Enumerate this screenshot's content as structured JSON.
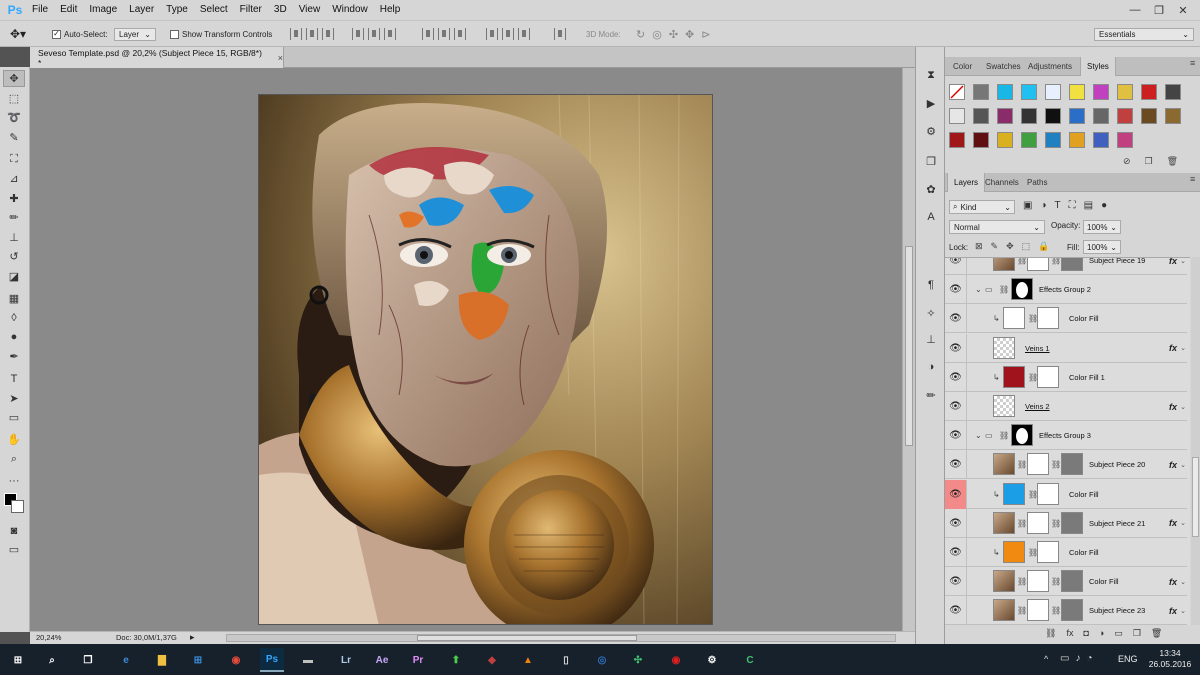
{
  "app": {
    "logo": "Ps"
  },
  "menu": [
    "File",
    "Edit",
    "Image",
    "Layer",
    "Type",
    "Select",
    "Filter",
    "3D",
    "View",
    "Window",
    "Help"
  ],
  "window_controls": {
    "minimize": "—",
    "maximize": "❐",
    "close": "✕"
  },
  "options": {
    "auto_select_label": "Auto-Select:",
    "auto_select_checked": true,
    "auto_select_target": "Layer",
    "transform_controls_label": "Show Transform Controls",
    "mode_label": "3D Mode:",
    "workspace": "Essentials"
  },
  "document": {
    "tab_title": "Seveso Template.psd @ 20,2% (Subject Piece 15, RGB/8*) *",
    "close": "×"
  },
  "status": {
    "zoom": "20,24%",
    "doc": "Doc: 30,0M/1,37G"
  },
  "tools": [
    {
      "icon": "move-icon",
      "glyph": "✥"
    },
    {
      "icon": "marquee-icon",
      "glyph": "⬚"
    },
    {
      "icon": "lasso-icon",
      "glyph": "➰"
    },
    {
      "icon": "quick-select-icon",
      "glyph": "✎"
    },
    {
      "icon": "crop-icon",
      "glyph": "⛶"
    },
    {
      "icon": "eyedropper-icon",
      "glyph": "⊿"
    },
    {
      "icon": "healing-brush-icon",
      "glyph": "✚"
    },
    {
      "icon": "brush-icon",
      "glyph": "✏"
    },
    {
      "icon": "clone-stamp-icon",
      "glyph": "⊥"
    },
    {
      "icon": "history-brush-icon",
      "glyph": "↺"
    },
    {
      "icon": "eraser-icon",
      "glyph": "◪"
    },
    {
      "icon": "gradient-icon",
      "glyph": "▦"
    },
    {
      "icon": "blur-icon",
      "glyph": "◊"
    },
    {
      "icon": "dodge-icon",
      "glyph": "●"
    },
    {
      "icon": "pen-icon",
      "glyph": "✒"
    },
    {
      "icon": "type-icon",
      "glyph": "T"
    },
    {
      "icon": "path-select-icon",
      "glyph": "➤"
    },
    {
      "icon": "shape-icon",
      "glyph": "▭"
    },
    {
      "icon": "hand-icon",
      "glyph": "✋"
    },
    {
      "icon": "zoom-icon",
      "glyph": "⌕"
    },
    {
      "icon": "more-tools-icon",
      "glyph": "···"
    }
  ],
  "side_strip_icons": [
    {
      "icon": "history-icon",
      "glyph": "⧗"
    },
    {
      "icon": "play-actions-icon",
      "glyph": "▶"
    },
    {
      "icon": "properties-icon",
      "glyph": "⚙"
    },
    {
      "icon": "clone-source-icon",
      "glyph": "❐"
    },
    {
      "icon": "brush-presets-icon",
      "glyph": "✿"
    },
    {
      "icon": "character-icon",
      "glyph": "A"
    },
    {
      "icon": "paragraph-icon",
      "glyph": "¶"
    },
    {
      "icon": "tool-presets-icon",
      "glyph": "✧"
    },
    {
      "icon": "3d-icon",
      "glyph": "⊥"
    },
    {
      "icon": "adjustments-icon",
      "glyph": "◑"
    },
    {
      "icon": "brush-icon",
      "glyph": "✏"
    }
  ],
  "panels": {
    "color_tabs": [
      "Color",
      "Swatches",
      "Adjustments",
      "Styles"
    ],
    "active_color_tab": "Styles",
    "styles": [
      "#ffffff",
      "#777777",
      "#18b7e6",
      "#20c0f0",
      "#e8f0ff",
      "#f0e040",
      "#c040c0",
      "#e0c040",
      "#cc2020",
      "#444444",
      "#e6e6e6",
      "#555555",
      "#8a2c6a",
      "#333333",
      "#101010",
      "#2a6ec8",
      "#666666",
      "#c04040",
      "#6a4a20",
      "#8a6a30",
      "#a01818",
      "#601010",
      "#d8b020",
      "#40a040",
      "#2080c0",
      "#e0a020",
      "#4060c0",
      "#c04080"
    ],
    "layers_tabs": [
      "Layers",
      "Channels",
      "Paths"
    ],
    "active_layers_tab": "Layers",
    "filter_kind": "Kind",
    "blend_mode": "Normal",
    "opacity_label": "Opacity:",
    "opacity": "100%",
    "lock_label": "Lock:",
    "fill_label": "Fill:",
    "fill": "100%"
  },
  "layers": [
    {
      "name": "Subject Piece 19",
      "indent": 1,
      "kind": "photo",
      "fx": "fx",
      "eye": true
    },
    {
      "name": "Effects Group 2",
      "indent": 1,
      "kind": "group",
      "fx": "",
      "eye": true
    },
    {
      "name": "Color Fill",
      "indent": 2,
      "kind": "fill",
      "color": "#ffffff",
      "fx": "",
      "eye": true
    },
    {
      "name": "Veins 1",
      "indent": 1,
      "kind": "pattern",
      "fx": "fx",
      "eye": true
    },
    {
      "name": "Color Fill 1",
      "indent": 2,
      "kind": "fill",
      "color": "#a0131c",
      "fx": "",
      "eye": true
    },
    {
      "name": "Veins 2",
      "indent": 1,
      "kind": "pattern",
      "fx": "fx",
      "eye": true
    },
    {
      "name": "Effects Group 3",
      "indent": 1,
      "kind": "group",
      "fx": "",
      "eye": true
    },
    {
      "name": "Subject Piece 20",
      "indent": 1,
      "kind": "photo",
      "fx": "fx",
      "eye": true
    },
    {
      "name": "Color Fill",
      "indent": 2,
      "kind": "fill",
      "color": "#1b9ee6",
      "fx": "",
      "eye": true,
      "red_eye": true
    },
    {
      "name": "Subject Piece 21",
      "indent": 1,
      "kind": "photo",
      "fx": "fx",
      "eye": true
    },
    {
      "name": "Color Fill",
      "indent": 2,
      "kind": "fill",
      "color": "#f08a10",
      "fx": "",
      "eye": true
    },
    {
      "name": "Color Fill",
      "indent": 1,
      "kind": "photo",
      "fx": "fx",
      "eye": true
    },
    {
      "name": "Subject Piece 23",
      "indent": 1,
      "kind": "photo",
      "fx": "fx",
      "eye": true
    }
  ],
  "layer_footer_icons": [
    "link-icon",
    "fx-icon",
    "mask-icon",
    "adjustment-icon",
    "group-icon",
    "new-layer-icon",
    "trash-icon"
  ],
  "taskbar": {
    "apps": [
      {
        "icon": "windows-start-icon",
        "glyph": "⊞",
        "color": "#ffffff"
      },
      {
        "icon": "search-icon",
        "glyph": "⌕",
        "color": "#ffffff"
      },
      {
        "icon": "task-view-icon",
        "glyph": "❐",
        "color": "#ffffff"
      },
      {
        "icon": "edge-icon",
        "glyph": "e",
        "color": "#3b8bd9"
      },
      {
        "icon": "explorer-icon",
        "glyph": "▇",
        "color": "#f0c040"
      },
      {
        "icon": "store-icon",
        "glyph": "⊞",
        "color": "#3b8bd9"
      },
      {
        "icon": "chrome-icon",
        "glyph": "◉",
        "color": "#e74c3c"
      },
      {
        "icon": "photoshop-icon",
        "glyph": "Ps",
        "color": "#31a8ff"
      },
      {
        "icon": "drive-icon",
        "glyph": "▬",
        "color": "#c0c0c0"
      },
      {
        "icon": "lightroom-icon",
        "glyph": "Lr",
        "color": "#b0c8e8"
      },
      {
        "icon": "after-effects-icon",
        "glyph": "Ae",
        "color": "#c8a8f8"
      },
      {
        "icon": "premiere-icon",
        "glyph": "Pr",
        "color": "#e08cf8"
      },
      {
        "icon": "upload-icon",
        "glyph": "⬆",
        "color": "#4cd04c"
      },
      {
        "icon": "winrar-icon",
        "glyph": "◆",
        "color": "#c04040"
      },
      {
        "icon": "vlc-icon",
        "glyph": "▲",
        "color": "#f08010"
      },
      {
        "icon": "file-icon",
        "glyph": "▯",
        "color": "#dddddd"
      },
      {
        "icon": "network-icon",
        "glyph": "◎",
        "color": "#3070c0"
      },
      {
        "icon": "camtasia-icon",
        "glyph": "✣",
        "color": "#40c070"
      },
      {
        "icon": "record-icon",
        "glyph": "◉",
        "color": "#e02020"
      },
      {
        "icon": "settings-icon",
        "glyph": "⚙",
        "color": "#ffffff"
      },
      {
        "icon": "camtasia-recorder-icon",
        "glyph": "C",
        "color": "#40c070"
      }
    ],
    "tray": {
      "chevron": "^",
      "lang": "ENG",
      "time": "13:34",
      "date": "26.05.2016"
    }
  }
}
